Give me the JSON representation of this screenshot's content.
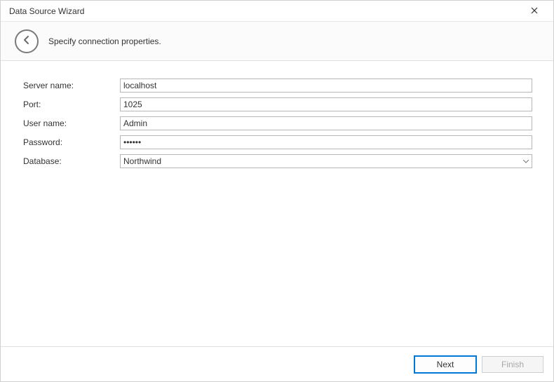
{
  "window": {
    "title": "Data Source Wizard"
  },
  "header": {
    "subtitle": "Specify connection properties."
  },
  "form": {
    "server_label": "Server name:",
    "server_value": "localhost",
    "port_label": "Port:",
    "port_value": "1025",
    "user_label": "User name:",
    "user_value": "Admin",
    "password_label": "Password:",
    "password_value": "••••••",
    "database_label": "Database:",
    "database_value": "Northwind"
  },
  "footer": {
    "next_label": "Next",
    "finish_label": "Finish"
  }
}
